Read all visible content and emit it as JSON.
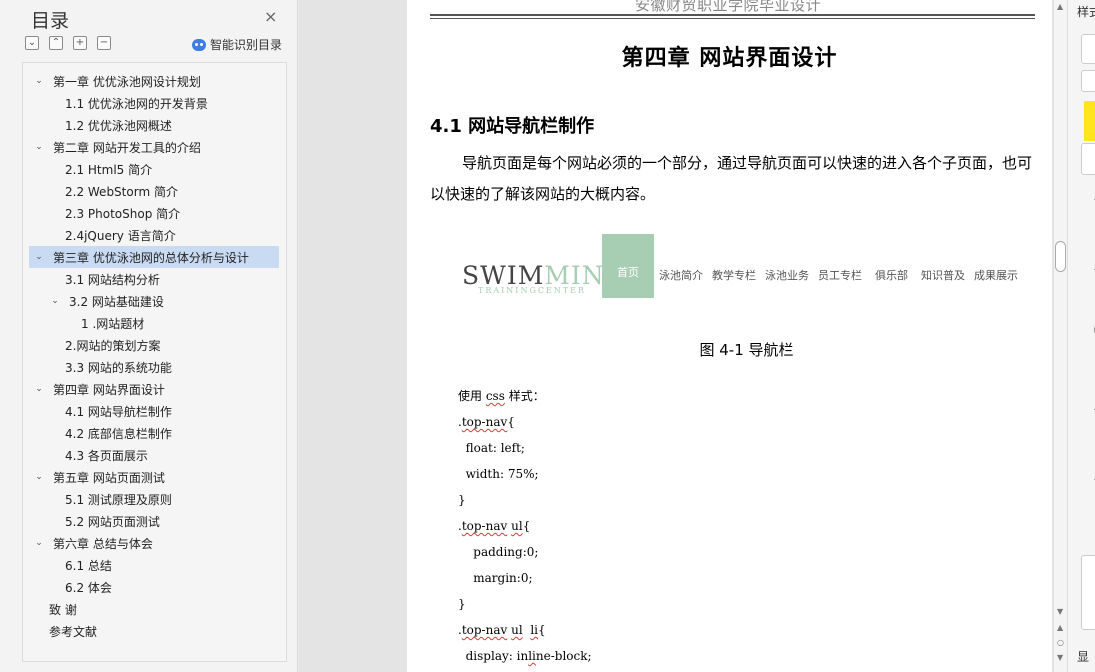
{
  "toc": {
    "title": "目录",
    "close_icon": "×",
    "tools": [
      "⌄",
      "⌃",
      "+",
      "−"
    ],
    "smart_label": "智能识别目录",
    "items": [
      {
        "label": "第一章  优优泳池网设计规划",
        "level": 1,
        "arrow": "⌄"
      },
      {
        "label": "1.1  优优泳池网的开发背景",
        "level": 2
      },
      {
        "label": "1.2 优优泳池网概述",
        "level": 2
      },
      {
        "label": "第二章  网站开发工具的介绍",
        "level": 1,
        "arrow": "⌄"
      },
      {
        "label": "2.1 Html5 简介",
        "level": 2
      },
      {
        "label": "2.2 WebStorm 简介",
        "level": 2
      },
      {
        "label": "2.3 PhotoShop 简介",
        "level": 2
      },
      {
        "label": "2.4jQuery 语言简介",
        "level": 2
      },
      {
        "label": "第三章  优优泳池网的总体分析与设计",
        "level": 1,
        "arrow": "⌄",
        "selected": true
      },
      {
        "label": "3.1  网站结构分析",
        "level": 2
      },
      {
        "label": "3.2  网站基础建设",
        "level": "2a",
        "arrow": "⌄"
      },
      {
        "label": "1 .网站题材",
        "level": 3
      },
      {
        "label": "2.网站的策划方案",
        "level": 2
      },
      {
        "label": "3.3 网站的系统功能",
        "level": 2
      },
      {
        "label": "第四章  网站界面设计",
        "level": 1,
        "arrow": "⌄"
      },
      {
        "label": "4.1  网站导航栏制作",
        "level": 2
      },
      {
        "label": "4.2 底部信息栏制作",
        "level": 2
      },
      {
        "label": "4.3  各页面展示",
        "level": 2
      },
      {
        "label": "第五章  网站页面测试",
        "level": 1,
        "arrow": "⌄"
      },
      {
        "label": "5.1 测试原理及原则",
        "level": 2
      },
      {
        "label": "5.2 网站页面测试",
        "level": 2
      },
      {
        "label": "第六章  总结与体会",
        "level": 1,
        "arrow": "⌄"
      },
      {
        "label": "6.1  总结",
        "level": 2
      },
      {
        "label": "6.2 体会",
        "level": 2
      },
      {
        "label": "致  谢",
        "level": "1n"
      },
      {
        "label": "参考文献",
        "level": "1n"
      }
    ]
  },
  "document": {
    "header": "安徽财贸职业学院毕业设计",
    "chapter_title": "第四章  网站界面设计",
    "section_title": "4.1  网站导航栏制作",
    "paragraph": "导航页面是每个网站必须的一个部分，通过导航页面可以快速的进入各个子页面，也可以快速的了解该网站的大概内容。",
    "nav_image": {
      "logo_main": "SWIM",
      "logo_accent": "MING",
      "logo_sub": "TRAININGCENTER",
      "home": "首页",
      "menu": [
        "泳池简介",
        "教学专栏",
        "泳池业务",
        "员工专栏",
        "俱乐部",
        "知识普及",
        "成果展示"
      ],
      "accent_color": "#a7cdb3"
    },
    "caption": "图 4-1 导航栏",
    "code_intro": "使用 css 样式：",
    "code_lines": [
      ".top-nav{",
      "  float: left;",
      "  width: 75%;",
      "}",
      ".top-nav ul{",
      "    padding:0;",
      "    margin:0;",
      "}",
      ".top-nav ul  li{",
      "  display: inline-block;"
    ]
  },
  "right_panel": {
    "label_top": "样式",
    "label_bottom": "显"
  }
}
